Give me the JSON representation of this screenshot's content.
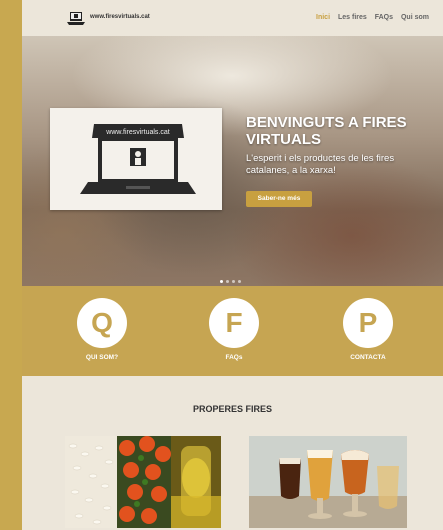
{
  "header": {
    "logo_text": "www.firesvirtuals.cat",
    "nav": [
      {
        "label": "Inici",
        "active": true
      },
      {
        "label": "Les fires",
        "active": false
      },
      {
        "label": "FAQs",
        "active": false
      },
      {
        "label": "Qui som",
        "active": false
      }
    ]
  },
  "hero": {
    "logo_url_text": "www.firesvirtuals.cat",
    "title": "BENVINGUTS A FIRES VIRTUALS",
    "subtitle": "L'esperit i els productes de les fires catalanes, a la xarxa!",
    "button_label": "Saber-ne més",
    "slide_count": 4,
    "active_slide": 1
  },
  "features": [
    {
      "letter": "Q",
      "label": "QUI SOM?"
    },
    {
      "letter": "F",
      "label": "FAQs"
    },
    {
      "letter": "P",
      "label": "CONTACTA"
    }
  ],
  "upcoming": {
    "title": "PROPERES FIRES"
  },
  "colors": {
    "accent": "#c6a552",
    "background": "#ece6da",
    "outer": "#c8a850"
  }
}
